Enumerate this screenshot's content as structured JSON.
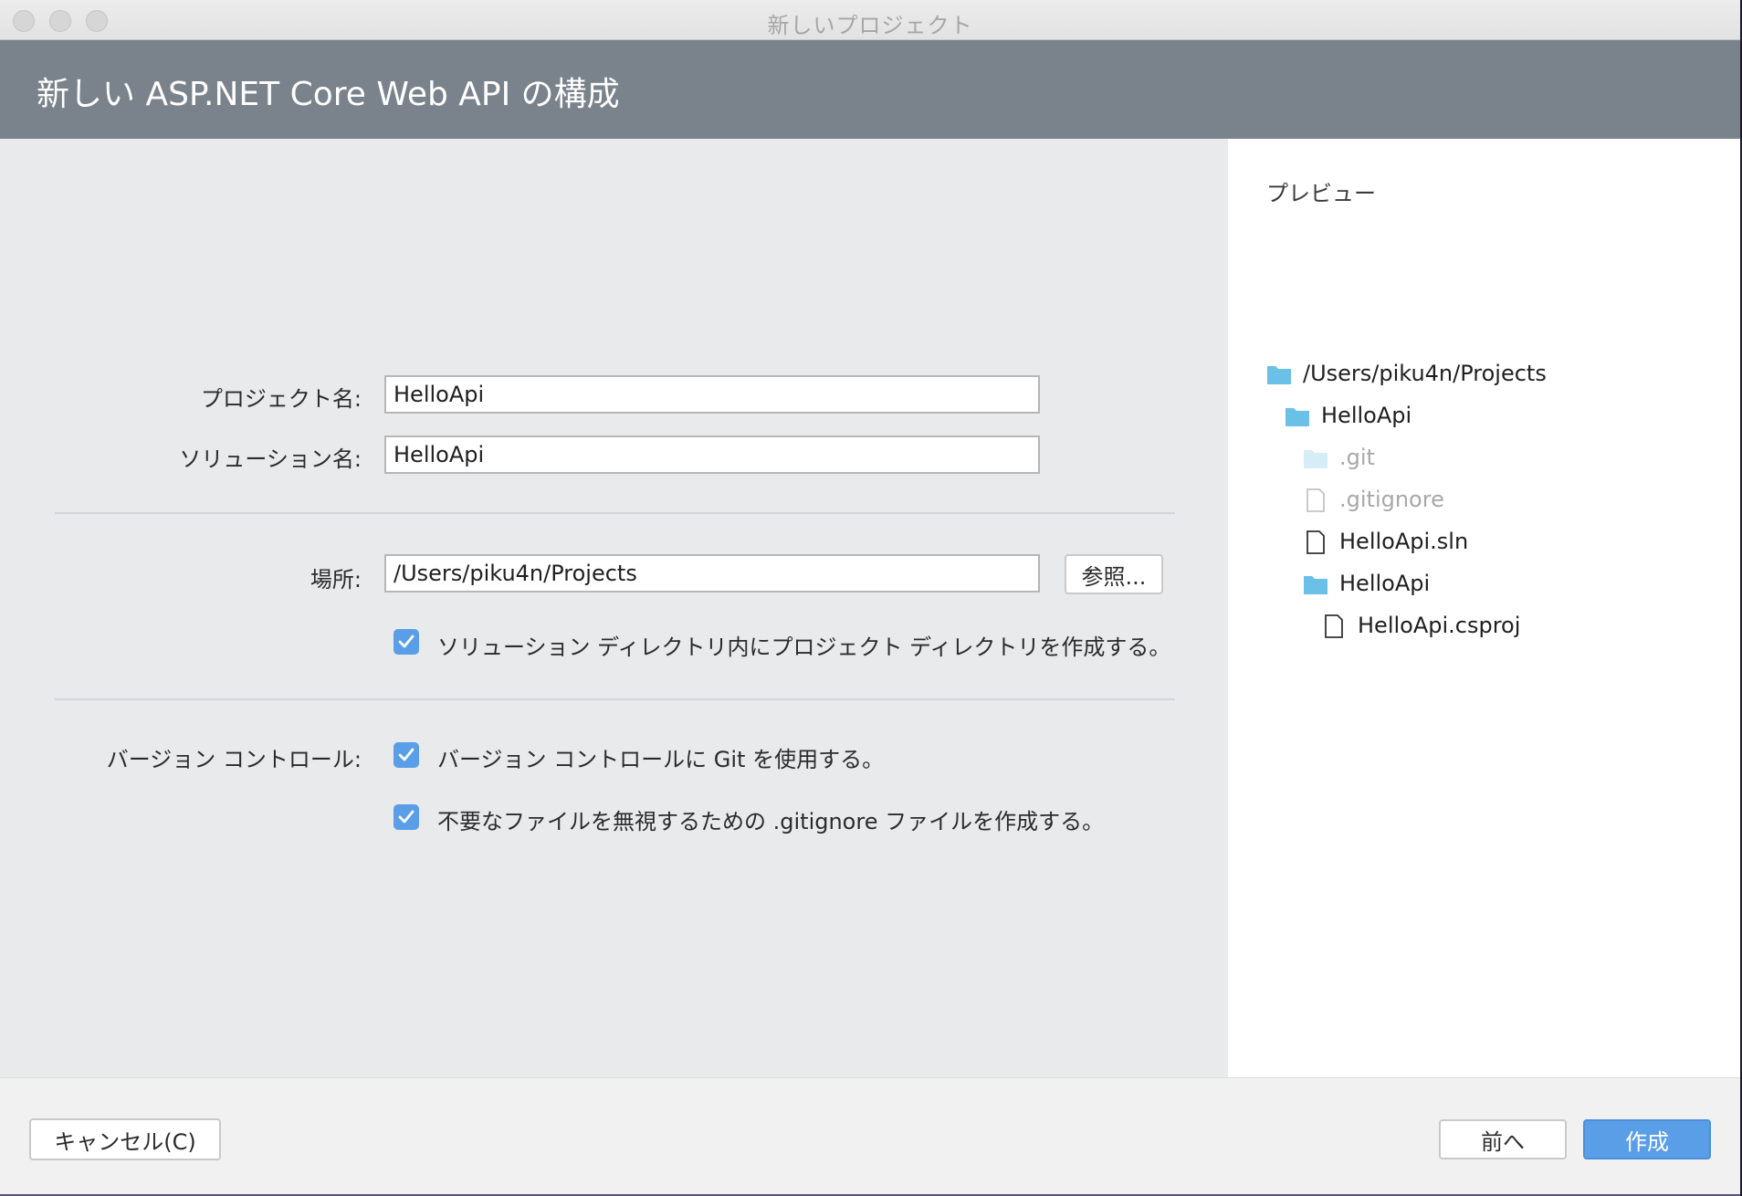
{
  "window": {
    "title": "新しいプロジェクト"
  },
  "header": {
    "title": "新しい ASP.NET Core Web API の構成"
  },
  "form": {
    "project_name_label": "プロジェクト名:",
    "project_name_value": "HelloApi",
    "solution_name_label": "ソリューション名:",
    "solution_name_value": "HelloApi",
    "location_label": "場所:",
    "location_value": "/Users/piku4n/Projects",
    "browse_label": "参照...",
    "create_dir_checkbox": {
      "checked": true,
      "label": "ソリューション ディレクトリ内にプロジェクト ディレクトリを作成する。"
    },
    "version_control_label": "バージョン コントロール:",
    "use_git_checkbox": {
      "checked": true,
      "label": "バージョン コントロールに Git を使用する。"
    },
    "gitignore_checkbox": {
      "checked": true,
      "label": "不要なファイルを無視するための .gitignore ファイルを作成する。"
    }
  },
  "preview": {
    "title": "プレビュー",
    "tree": [
      {
        "name": "/Users/piku4n/Projects",
        "type": "folder",
        "dim": false
      },
      {
        "name": "HelloApi",
        "type": "folder",
        "dim": false
      },
      {
        "name": ".git",
        "type": "folder",
        "dim": true
      },
      {
        "name": ".gitignore",
        "type": "file",
        "dim": true
      },
      {
        "name": "HelloApi.sln",
        "type": "file",
        "dim": false
      },
      {
        "name": "HelloApi",
        "type": "folder",
        "dim": false
      },
      {
        "name": "HelloApi.csproj",
        "type": "file",
        "dim": false
      }
    ]
  },
  "footer": {
    "cancel_label": "キャンセル(C)",
    "back_label": "前へ",
    "create_label": "作成"
  },
  "colors": {
    "accent": "#5a9ee8",
    "header_bg": "#7a828c",
    "folder": "#6ac0e6",
    "folder_dim": "#d6ecf7"
  }
}
